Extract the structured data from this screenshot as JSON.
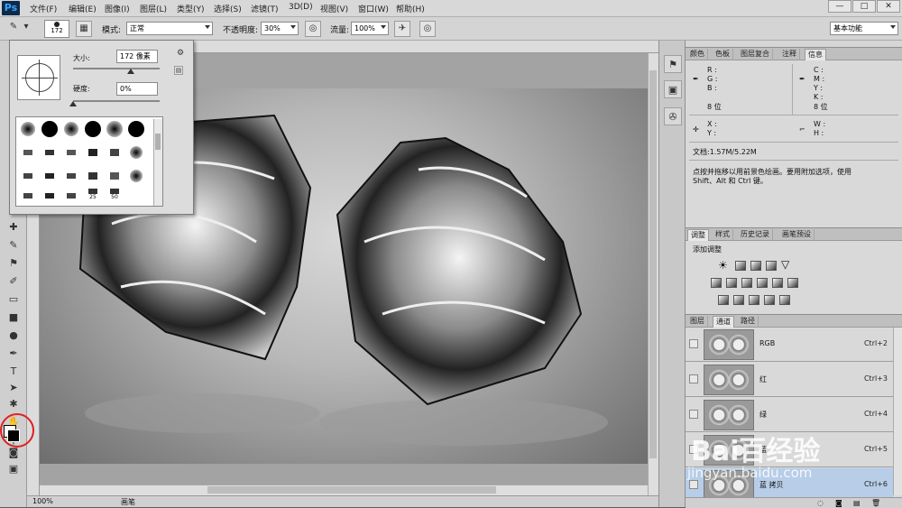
{
  "app": {
    "logo": "Ps"
  },
  "menu": [
    "文件(F)",
    "编辑(E)",
    "图像(I)",
    "图层(L)",
    "类型(Y)",
    "选择(S)",
    "滤镜(T)",
    "3D(D)",
    "视图(V)",
    "窗口(W)",
    "帮助(H)"
  ],
  "window_buttons": [
    "—",
    "□",
    "✕"
  ],
  "options": {
    "brush_size": "172",
    "mode_label": "模式:",
    "mode_value": "正常",
    "opacity_label": "不透明度:",
    "opacity_value": "30%",
    "flow_label": "流量:",
    "flow_value": "100%",
    "workspace": "基本功能"
  },
  "brush_popup": {
    "size_label": "大小:",
    "size_value": "172 像素",
    "hardness_label": "硬度:",
    "hardness_value": "0%",
    "preset_labels": [
      "25",
      "50"
    ]
  },
  "info_panel": {
    "tabs": [
      "颜色",
      "色板",
      "图层复合",
      "注释",
      "信息"
    ],
    "rgb_labels": [
      "R :",
      "G :",
      "B :"
    ],
    "cmyk_labels": [
      "C :",
      "M :",
      "Y :",
      "K :"
    ],
    "bits_left": "8 位",
    "bits_right": "8 位",
    "xy_labels": [
      "X :",
      "Y :"
    ],
    "wh_labels": [
      "W :",
      "H :"
    ],
    "doc_info": "文档:1.57M/5.22M",
    "hint_line1": "点按并拖移以用前景色绘画。要用附加选项，使用",
    "hint_line2": "Shift、Alt 和 Ctrl 键。"
  },
  "adjust_panel": {
    "tabs": [
      "调整",
      "样式",
      "历史记录",
      "画笔预设"
    ],
    "title": "添加调整"
  },
  "channels_panel": {
    "tabs": [
      "图层",
      "通道",
      "路径"
    ],
    "rows": [
      {
        "name": "RGB",
        "shortcut": "Ctrl+2"
      },
      {
        "name": "红",
        "shortcut": "Ctrl+3"
      },
      {
        "name": "绿",
        "shortcut": "Ctrl+4"
      },
      {
        "name": "蓝",
        "shortcut": "Ctrl+5"
      },
      {
        "name": "蓝 拷贝",
        "shortcut": "Ctrl+6"
      }
    ]
  },
  "status": {
    "zoom": "100%",
    "label": "画笔"
  },
  "watermark": {
    "brand": "Bai百经验",
    "url": "jingyan.baidu.com"
  },
  "icons": [
    "brush-icon",
    "brush-preset-icon",
    "airbrush-icon",
    "pressure-icon",
    "move-icon",
    "marquee-icon",
    "lasso-icon",
    "magic-wand-icon",
    "crop-icon",
    "eyedropper-icon",
    "healing-icon",
    "brush-tool-icon",
    "stamp-icon",
    "history-brush-icon",
    "eraser-icon",
    "gradient-icon",
    "blur-icon",
    "dodge-icon",
    "pen-icon",
    "type-icon",
    "path-select-icon",
    "shape-icon",
    "hand-icon",
    "zoom-icon",
    "swap-colors-icon",
    "default-colors-icon",
    "quickmask-icon",
    "screen-mode-icon",
    "eye-icon",
    "gear-icon"
  ]
}
